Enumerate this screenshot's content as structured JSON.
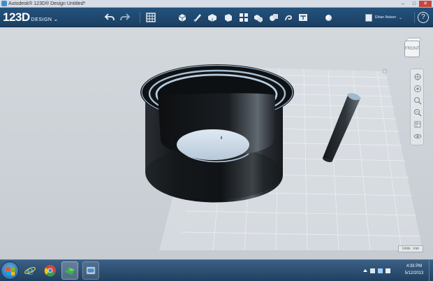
{
  "window": {
    "title": "Autodesk® 123D® Design Untitled*",
    "min_glyph": "–",
    "max_glyph": "□",
    "close_glyph": "✕"
  },
  "app": {
    "logo_main": "123D",
    "logo_sub": "DESIGN",
    "logo_chevron": "⌄"
  },
  "toolbar": {
    "icons": [
      "undo-icon",
      "redo-icon",
      "grid-icon",
      "transform-icon",
      "sketch-icon",
      "construct-icon",
      "modify-icon",
      "pattern-icon",
      "group-icon",
      "combine-icon",
      "measure-icon",
      "text-icon",
      "material-icon"
    ],
    "user_name": "Ethan Nelson",
    "user_chevron": "⌄",
    "help_label": "?"
  },
  "viewcube": {
    "face_label": "FRONT"
  },
  "units_label": "Units : mm",
  "taskbar": {
    "apps": [
      "internet-explorer-icon",
      "chrome-icon",
      "123d-design-icon",
      "windows-explorer-icon"
    ],
    "time": "4:33 PM",
    "date": "5/12/2013"
  },
  "colors": {
    "toolbar": "#1f4a72",
    "taskbar": "#2a4e73",
    "viewport": "#cdd2d8",
    "model": "#1e2226"
  }
}
